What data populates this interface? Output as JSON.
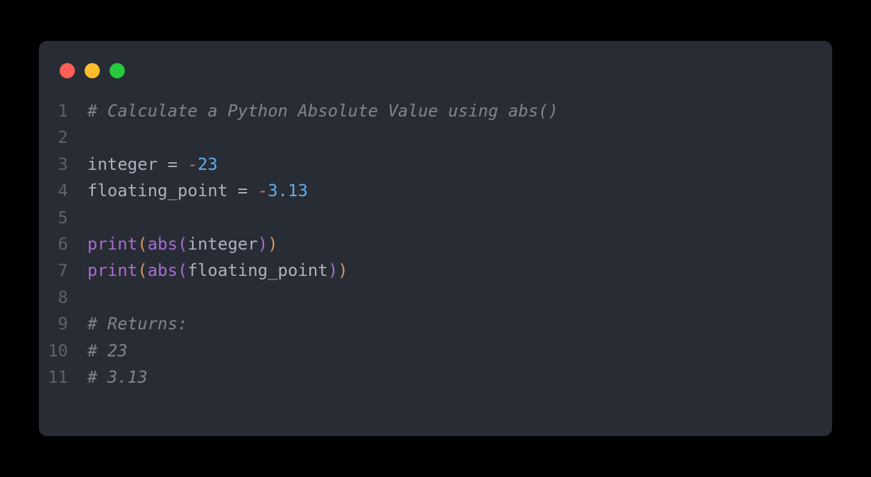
{
  "window": {
    "controls": {
      "close": "close",
      "minimize": "minimize",
      "maximize": "maximize"
    }
  },
  "code": {
    "lines": [
      {
        "num": "1",
        "tokens": [
          {
            "t": "# Calculate a Python Absolute Value using abs()",
            "c": "tok-comment"
          }
        ]
      },
      {
        "num": "2",
        "tokens": []
      },
      {
        "num": "3",
        "tokens": [
          {
            "t": "integer ",
            "c": "tok-identifier"
          },
          {
            "t": "=",
            "c": "tok-operator"
          },
          {
            "t": " ",
            "c": ""
          },
          {
            "t": "-",
            "c": "tok-minus"
          },
          {
            "t": "23",
            "c": "tok-number"
          }
        ]
      },
      {
        "num": "4",
        "tokens": [
          {
            "t": "floating_point ",
            "c": "tok-identifier"
          },
          {
            "t": "=",
            "c": "tok-operator"
          },
          {
            "t": " ",
            "c": ""
          },
          {
            "t": "-",
            "c": "tok-minus"
          },
          {
            "t": "3.13",
            "c": "tok-number"
          }
        ]
      },
      {
        "num": "5",
        "tokens": []
      },
      {
        "num": "6",
        "tokens": [
          {
            "t": "print",
            "c": "tok-builtin"
          },
          {
            "t": "(",
            "c": "tok-paren"
          },
          {
            "t": "abs",
            "c": "tok-builtin"
          },
          {
            "t": "(",
            "c": "tok-paren2"
          },
          {
            "t": "integer",
            "c": "tok-identifier"
          },
          {
            "t": ")",
            "c": "tok-paren2"
          },
          {
            "t": ")",
            "c": "tok-paren"
          }
        ]
      },
      {
        "num": "7",
        "tokens": [
          {
            "t": "print",
            "c": "tok-builtin"
          },
          {
            "t": "(",
            "c": "tok-paren"
          },
          {
            "t": "abs",
            "c": "tok-builtin"
          },
          {
            "t": "(",
            "c": "tok-paren2"
          },
          {
            "t": "floating_point",
            "c": "tok-identifier"
          },
          {
            "t": ")",
            "c": "tok-paren2"
          },
          {
            "t": ")",
            "c": "tok-paren"
          }
        ]
      },
      {
        "num": "8",
        "tokens": []
      },
      {
        "num": "9",
        "tokens": [
          {
            "t": "# Returns:",
            "c": "tok-comment"
          }
        ]
      },
      {
        "num": "10",
        "tokens": [
          {
            "t": "# 23",
            "c": "tok-comment"
          }
        ]
      },
      {
        "num": "11",
        "tokens": [
          {
            "t": "# 3.13",
            "c": "tok-comment"
          }
        ]
      }
    ]
  }
}
